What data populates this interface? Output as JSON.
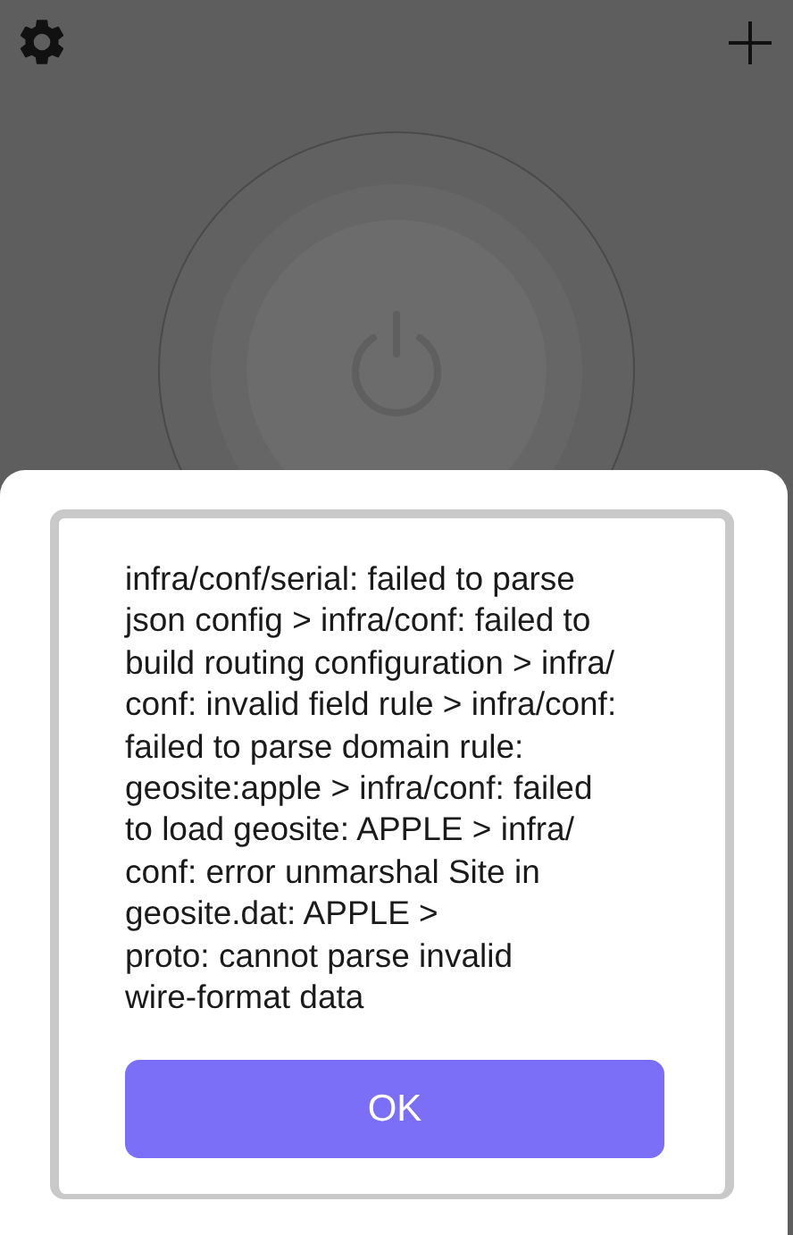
{
  "dialog": {
    "message_lines": [
      "infra/conf/serial: failed to parse",
      "json config > infra/conf: failed to",
      "build routing configuration > infra/",
      "conf: invalid field rule > infra/conf:",
      "failed to parse domain rule:",
      "geosite:apple > infra/conf: failed",
      "to load geosite: APPLE > infra/",
      "conf: error unmarshal Site in",
      "geosite.dat: APPLE >",
      "proto: cannot parse invalid",
      "wire-format data"
    ],
    "button": "OK"
  }
}
